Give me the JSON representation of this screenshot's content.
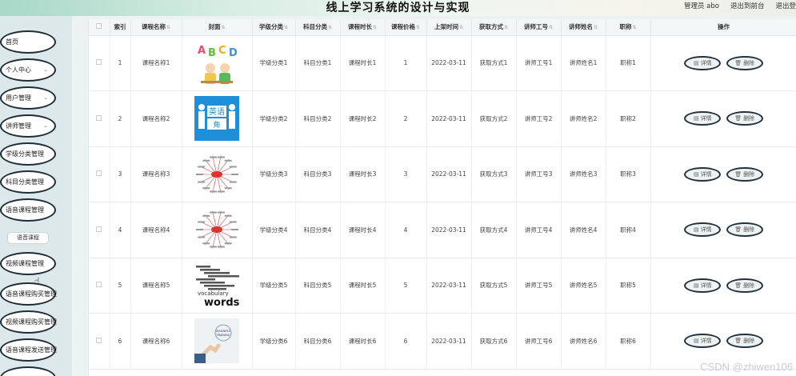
{
  "header": {
    "title": "线上学习系统的设计与实现",
    "admin_label": "管理员 abo",
    "front_label": "退出到前台",
    "logout_label": "退出登"
  },
  "sidebar": {
    "items": [
      {
        "label": "首页",
        "chev": ""
      },
      {
        "label": "个人中心",
        "chev": "⌄"
      },
      {
        "label": "用户管理",
        "chev": "⌄"
      },
      {
        "label": "讲师管理",
        "chev": "⌄"
      },
      {
        "label": "学级分类管理",
        "chev": ""
      },
      {
        "label": "科目分类管理",
        "chev": ""
      },
      {
        "label": "语音课程管理",
        "chev": ""
      },
      {
        "label": "视频课程管理",
        "chev": ""
      },
      {
        "label": "语音课程购买管理",
        "chev": ""
      },
      {
        "label": "视频课程购买管理",
        "chev": ""
      },
      {
        "label": "语音课程发送管理",
        "chev": ""
      }
    ],
    "sub_item": "语音课程"
  },
  "table": {
    "headers": [
      "索引",
      "课程名称",
      "封面",
      "学级分类",
      "科目分类",
      "课程时长",
      "课程价格",
      "上架时间",
      "获取方式",
      "讲师工号",
      "讲师姓名",
      "职称",
      "操作"
    ],
    "detail_label": "详情",
    "delete_label": "删除",
    "rows": [
      {
        "index": "1",
        "name": "课程名称1",
        "cover": "abcd-kids",
        "grade": "学级分类1",
        "subject": "科目分类1",
        "duration": "课程时长1",
        "price": "1",
        "date": "2022-03-11",
        "method": "获取方式1",
        "tid": "讲师工号1",
        "tname": "讲师姓名1",
        "title": "职称1"
      },
      {
        "index": "2",
        "name": "课程名称2",
        "cover": "english-corner",
        "grade": "学级分类2",
        "subject": "科目分类2",
        "duration": "课程时长2",
        "price": "2",
        "date": "2022-03-11",
        "method": "获取方式2",
        "tid": "讲师工号2",
        "tname": "讲师姓名2",
        "title": "职称2"
      },
      {
        "index": "3",
        "name": "课程名称3",
        "cover": "mindmap",
        "grade": "学级分类3",
        "subject": "科目分类3",
        "duration": "课程时长3",
        "price": "3",
        "date": "2022-03-11",
        "method": "获取方式3",
        "tid": "讲师工号3",
        "tname": "讲师姓名3",
        "title": "职称3"
      },
      {
        "index": "4",
        "name": "课程名称4",
        "cover": "mindmap",
        "grade": "学级分类4",
        "subject": "科目分类4",
        "duration": "课程时长4",
        "price": "4",
        "date": "2022-03-11",
        "method": "获取方式4",
        "tid": "讲师工号4",
        "tname": "讲师姓名4",
        "title": "职称4"
      },
      {
        "index": "5",
        "name": "课程名称5",
        "cover": "vocabulary-words",
        "grade": "学级分类5",
        "subject": "科目分类5",
        "duration": "课程时长5",
        "price": "5",
        "date": "2022-03-11",
        "method": "获取方式5",
        "tid": "讲师工号5",
        "tname": "讲师姓名5",
        "title": "职称5"
      },
      {
        "index": "6",
        "name": "课程名称6",
        "cover": "business-training",
        "grade": "学级分类6",
        "subject": "科目分类6",
        "duration": "课程时长6",
        "price": "6",
        "date": "2022-03-11",
        "method": "获取方式6",
        "tid": "讲师工号6",
        "tname": "讲师姓名6",
        "title": "职称6"
      }
    ]
  },
  "cover_text": {
    "abcd": [
      "A",
      "B",
      "C",
      "D"
    ],
    "english_top": "英语",
    "english_bottom": "角",
    "words_top": "vocabulary",
    "words_main": "words",
    "biz": "BUSINESS TRAINING"
  },
  "watermark": "CSDN @zhiwen106",
  "colors": {
    "accent": "#1f2d3a",
    "sidebar_bg": "#dce8ea",
    "english_blue": "#1e8fd8"
  }
}
